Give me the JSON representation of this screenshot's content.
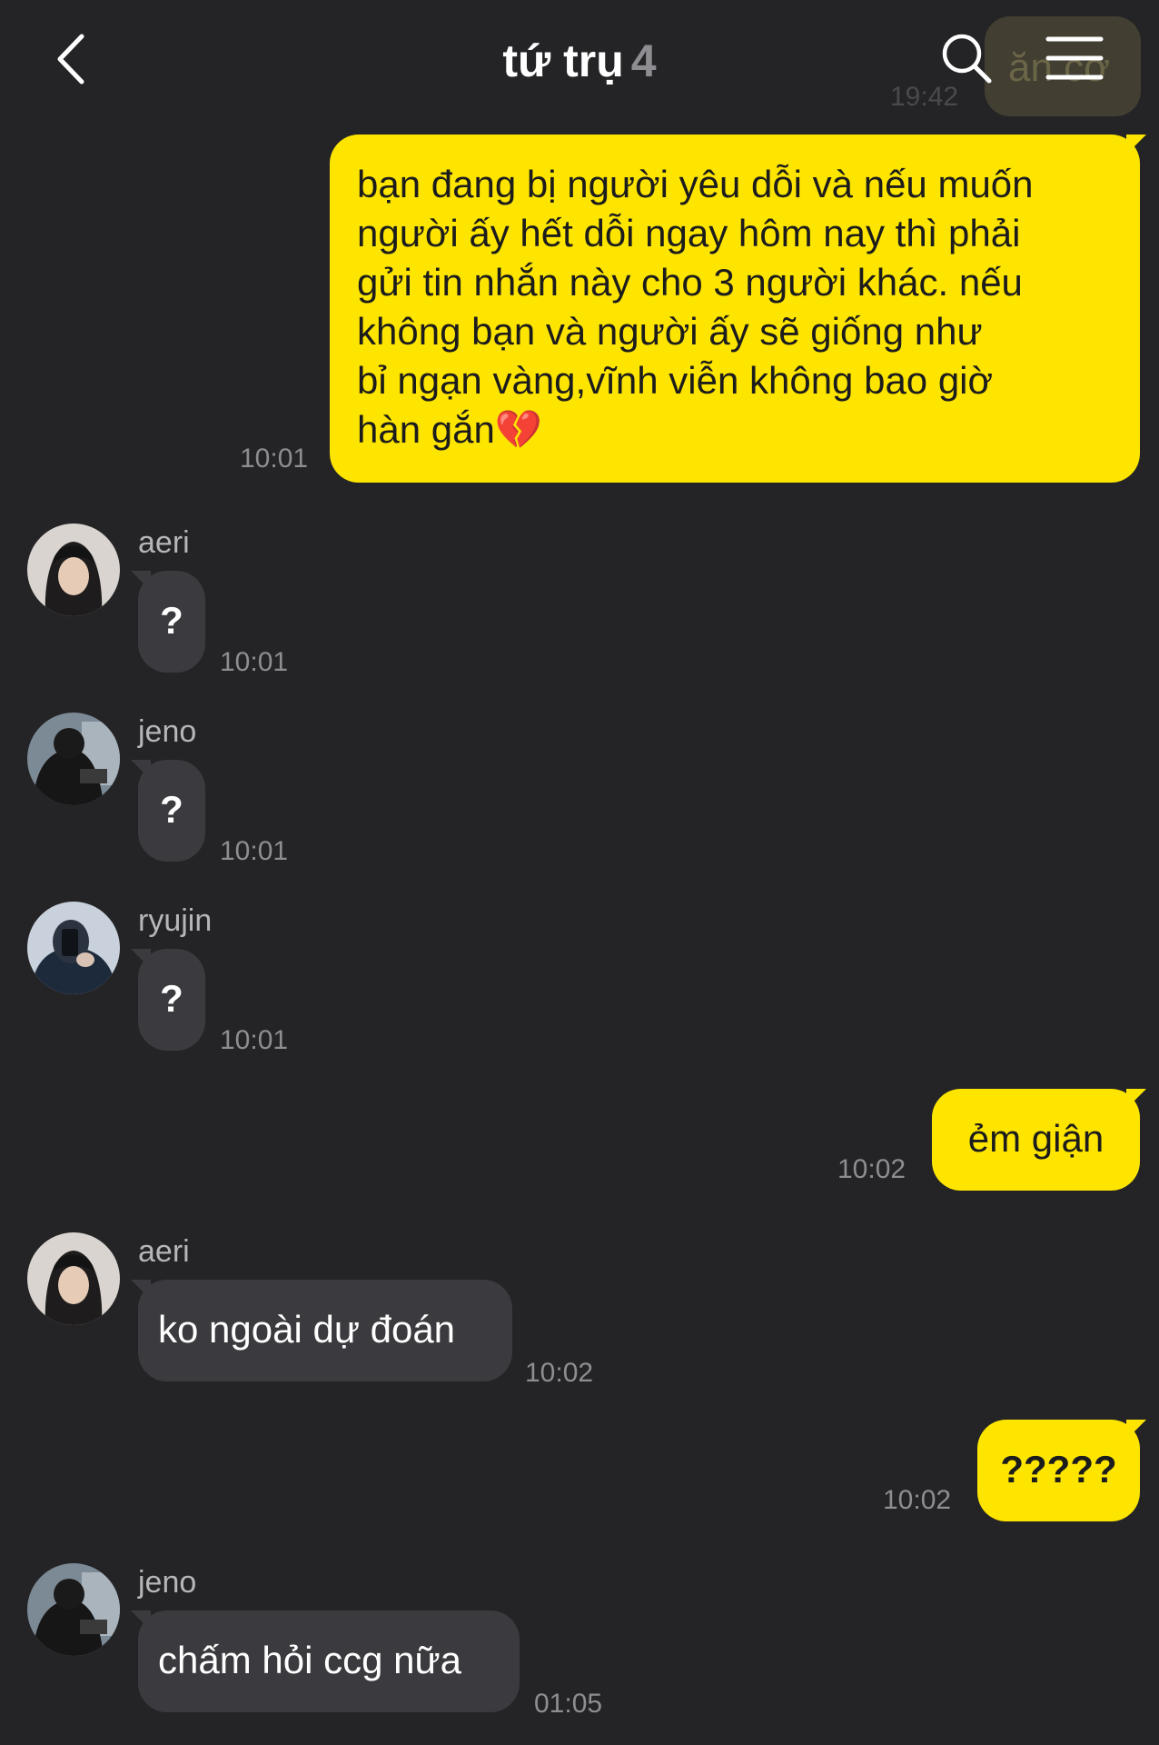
{
  "header": {
    "title": "tứ trụ",
    "member_count": "4"
  },
  "partial_previous": {
    "text": "ăn cơ",
    "time": "19:42"
  },
  "messages": [
    {
      "side": "mine",
      "text": "bạn đang bị người yêu dỗi và nếu muốn\nngười ấy hết dỗi ngay hôm nay thì phải\ngửi tin nhắn này cho 3 người khác. nếu\nkhông bạn và người ấy sẽ giống như\nbỉ ngạn vàng,vĩnh viễn không bao giờ\nhàn gắn💔",
      "time": "10:01"
    },
    {
      "side": "theirs",
      "sender": "aeri",
      "avatar": "aeri-avatar",
      "text": "?",
      "time": "10:01"
    },
    {
      "side": "theirs",
      "sender": "jeno",
      "avatar": "jeno-avatar",
      "text": "?",
      "time": "10:01"
    },
    {
      "side": "theirs",
      "sender": "ryujin",
      "avatar": "ryujin-avatar",
      "text": "?",
      "time": "10:01"
    },
    {
      "side": "mine",
      "text": "ẻm giận",
      "time": "10:02"
    },
    {
      "side": "theirs",
      "sender": "aeri",
      "avatar": "aeri-avatar",
      "text": "ko ngoài dự đoán",
      "time": "10:02"
    },
    {
      "side": "mine",
      "text": "?????",
      "time": "10:02"
    },
    {
      "side": "theirs",
      "sender": "jeno",
      "avatar": "jeno-avatar",
      "text": "chấm hỏi ccg nữa",
      "time": "01:05"
    }
  ],
  "icons": {
    "back": "chevron-left-icon",
    "search": "search-icon",
    "menu": "hamburger-menu-icon"
  },
  "colors": {
    "background": "#242426",
    "my_bubble": "#fee500",
    "their_bubble": "#3b3b3f",
    "timestamp": "#8d8d92"
  }
}
